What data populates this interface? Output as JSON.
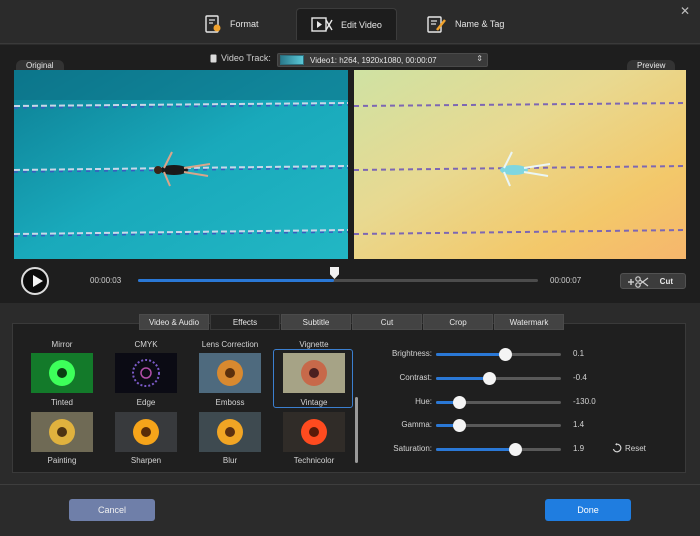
{
  "window": {
    "close_icon": "close-icon"
  },
  "top_tabs": [
    {
      "label": "Format",
      "icon": "format-icon",
      "active": false
    },
    {
      "label": "Edit Video",
      "icon": "edit-video-icon",
      "active": true
    },
    {
      "label": "Name & Tag",
      "icon": "name-tag-icon",
      "active": false
    }
  ],
  "video_track": {
    "label": "Video Track:",
    "value": "Video1: h264, 1920x1080, 00:00:07"
  },
  "panes": {
    "original_label": "Original",
    "preview_label": "Preview"
  },
  "playback": {
    "current_time": "00:00:03",
    "total_time": "00:00:07",
    "progress": 0.49,
    "cut_label": "Cut"
  },
  "editor_tabs": [
    {
      "label": "Video & Audio",
      "active": false
    },
    {
      "label": "Effects",
      "active": true
    },
    {
      "label": "Subtitle",
      "active": false
    },
    {
      "label": "Cut",
      "active": false
    },
    {
      "label": "Crop",
      "active": false
    },
    {
      "label": "Watermark",
      "active": false
    }
  ],
  "effects": {
    "top_row_labels": [
      "Mirror",
      "CMYK",
      "Lens Correction",
      "Vignette"
    ],
    "row1": [
      {
        "label": "Tinted",
        "style": "tinted"
      },
      {
        "label": "Edge",
        "style": "edge"
      },
      {
        "label": "Emboss",
        "style": "emboss"
      },
      {
        "label": "Vintage",
        "style": "vintage",
        "selected": true
      }
    ],
    "row2": [
      {
        "label": "Painting",
        "style": "painting"
      },
      {
        "label": "Sharpen",
        "style": "sharpen"
      },
      {
        "label": "Blur",
        "style": "blur"
      },
      {
        "label": "Technicolor",
        "style": "technicolor"
      }
    ]
  },
  "adjustments": [
    {
      "label": "Brightness:",
      "value": "0.1",
      "level": 0.55
    },
    {
      "label": "Contrast:",
      "value": "-0.4",
      "level": 0.42
    },
    {
      "label": "Hue:",
      "value": "-130.0",
      "level": 0.18
    },
    {
      "label": "Gamma:",
      "value": "1.4",
      "level": 0.18
    },
    {
      "label": "Saturation:",
      "value": "1.9",
      "level": 0.63
    }
  ],
  "reset_label": "Reset",
  "footer": {
    "cancel_label": "Cancel",
    "done_label": "Done"
  }
}
